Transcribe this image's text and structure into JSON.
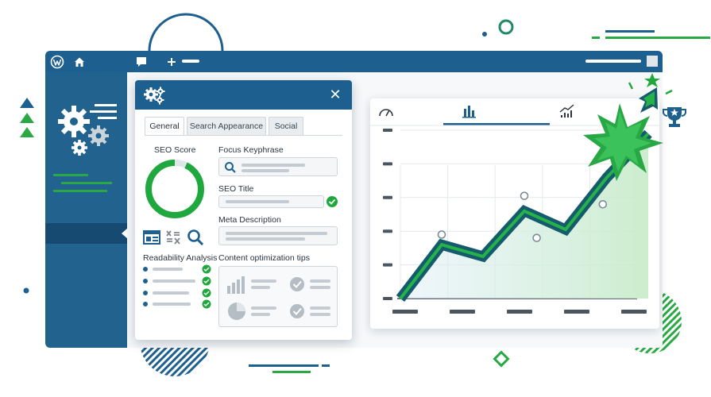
{
  "panel": {
    "tabs": [
      "General",
      "Search Appearance",
      "Social"
    ],
    "seo_score_label": "SEO Score",
    "seo_score_fraction": 0.93,
    "focus_keyphrase_label": "Focus Keyphrase",
    "seo_title_label": "SEO Title",
    "meta_description_label": "Meta Description",
    "readability_label": "Readability Analysis",
    "content_tips_label": "Content optimization tips",
    "close_glyph": "✕"
  },
  "colors": {
    "brand_blue": "#1d5f8e",
    "sidebar_blue": "#21628f",
    "accent_green": "#2aa845",
    "dark_teal": "#145c6b"
  },
  "chart_data": {
    "type": "line",
    "tabs": [
      "gauge-icon",
      "bar-chart-icon",
      "line-chart-icon"
    ],
    "active_tab": 1,
    "series": [
      {
        "values": [
          0,
          3.2,
          2.5,
          5.2,
          4.1,
          7.2,
          9.8
        ]
      }
    ],
    "points": [
      {
        "x": 1,
        "y": 3.8
      },
      {
        "x": 3,
        "y": 6.1
      },
      {
        "x": 3.3,
        "y": 3.6
      },
      {
        "x": 4.9,
        "y": 5.6
      }
    ],
    "ylim": [
      0,
      10
    ],
    "grid": true
  }
}
